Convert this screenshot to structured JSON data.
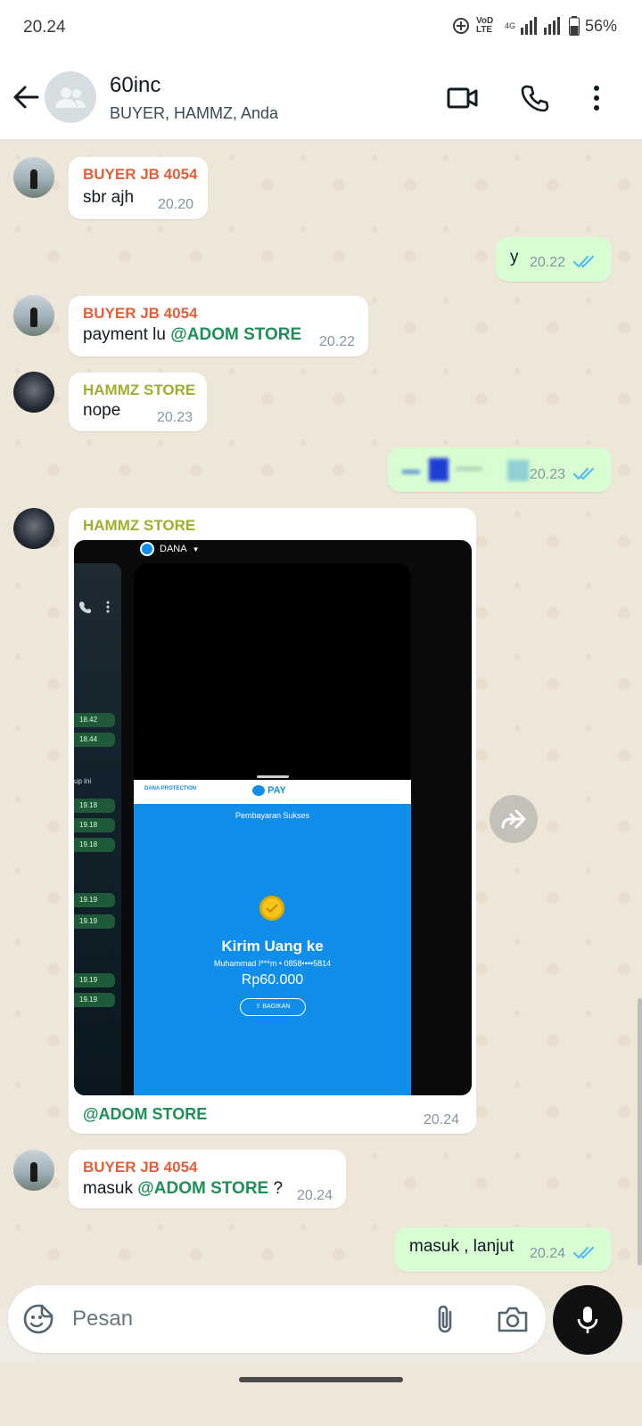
{
  "status": {
    "time": "20.24",
    "network": "VoD LTE",
    "network_type": "4G",
    "battery": "56%"
  },
  "header": {
    "title": "60inc",
    "subtitle": "BUYER, HAMMZ, Anda"
  },
  "messages": [
    {
      "sender": "BUYER JB 4054",
      "text": "sbr ajh",
      "time": "20.20"
    },
    {
      "text": "y",
      "time": "20.22"
    },
    {
      "sender": "BUYER JB 4054",
      "text": "payment lu",
      "mention": "@ADOM STORE",
      "time": "20.22"
    },
    {
      "sender": "HAMMZ STORE",
      "text": "nope",
      "time": "20.23"
    },
    {
      "time": "20.23"
    },
    {
      "sender": "HAMMZ STORE",
      "caption": "@ADOM STORE",
      "time": "20.24"
    },
    {
      "sender": "BUYER JB 4054",
      "text": "masuk",
      "mention": "@ADOM STORE",
      "suffix": "?",
      "time": "20.24"
    },
    {
      "text": "masuk , lanjut",
      "time": "20.24"
    }
  ],
  "screenshot": {
    "app": "DANA",
    "protection": "DANA PROTECTION",
    "pay": "PAY",
    "status": "Pembayaran Sukses",
    "heading": "Kirim Uang ke",
    "recipient": "Muhammad I***m • 0858••••5814",
    "amount": "Rp60.000",
    "share": "BAGIKAN",
    "bg_times": [
      "18.42",
      "18.44",
      "19.18",
      "19.18",
      "19.18",
      "19.19",
      "19.19",
      "19.19",
      "19.19"
    ],
    "bg_snippet": "up ini"
  },
  "composer": {
    "placeholder": "Pesan"
  },
  "colors": {
    "outgoing": "#d9fdd3",
    "incoming": "#ffffff",
    "mention": "#1f8f58",
    "sender_orange": "#e25f3a",
    "sender_olive": "#9fae2c",
    "dana_blue": "#118ee9",
    "tick_blue": "#53bdeb"
  }
}
